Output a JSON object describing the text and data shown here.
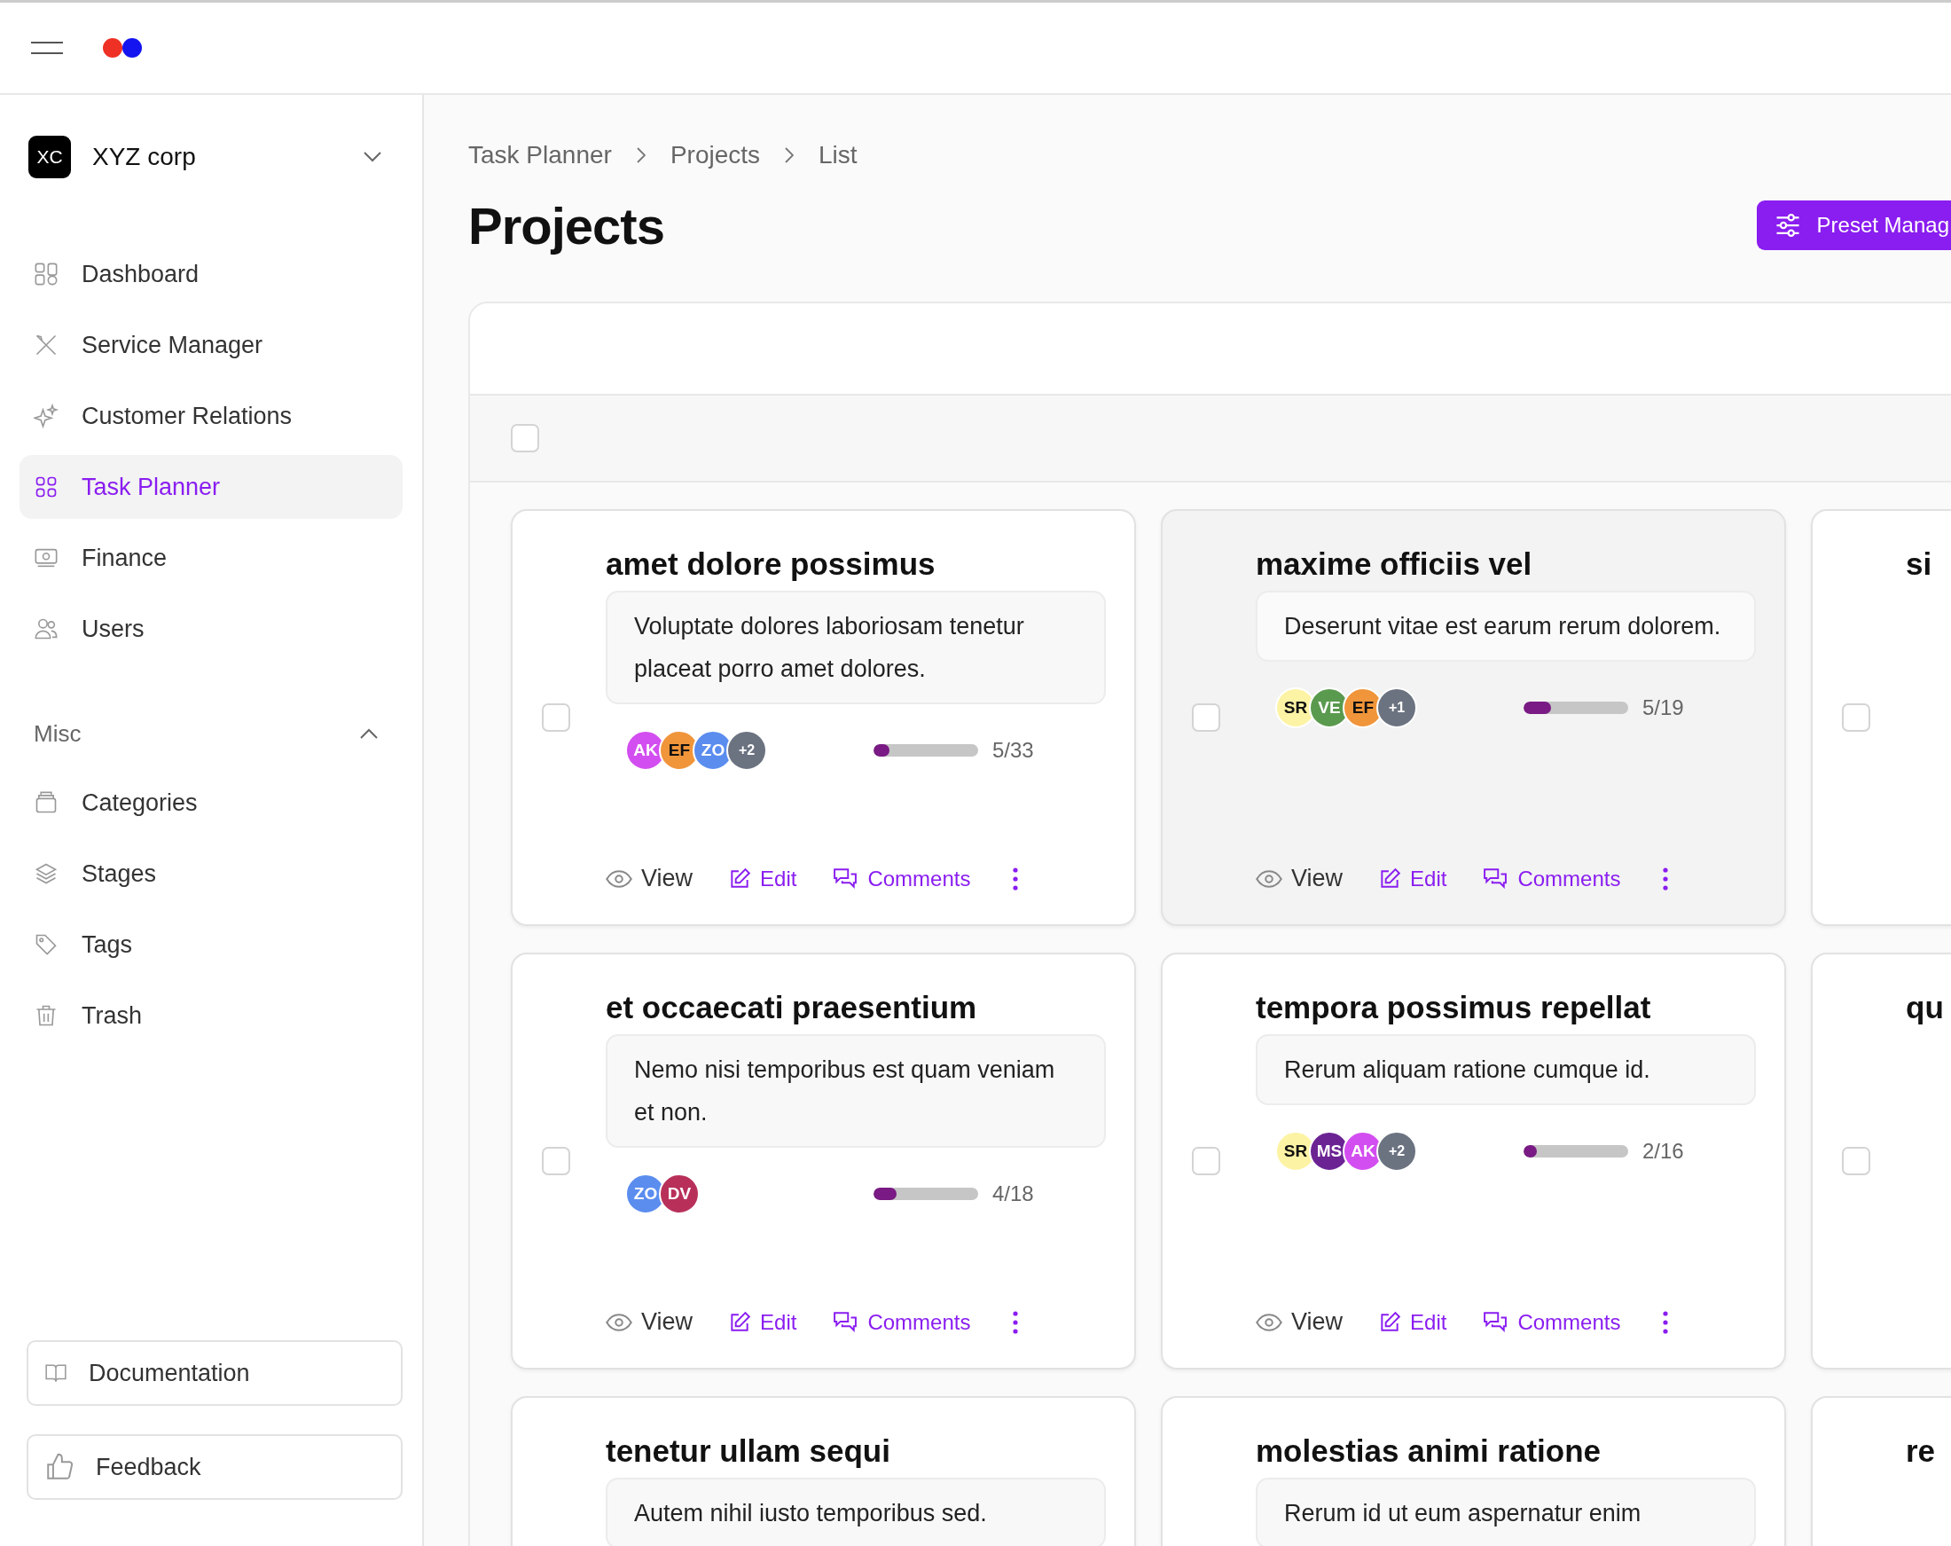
{
  "header": {
    "logo_dots": [
      {
        "color": "#ee3124"
      },
      {
        "color": "#1414f0"
      }
    ]
  },
  "org": {
    "badge": "XC",
    "name": "XYZ corp"
  },
  "nav": [
    {
      "label": "Dashboard",
      "selected": false
    },
    {
      "label": "Service Manager",
      "selected": false
    },
    {
      "label": "Customer Relations",
      "selected": false
    },
    {
      "label": "Task Planner",
      "selected": true
    },
    {
      "label": "Finance",
      "selected": false
    },
    {
      "label": "Users",
      "selected": false
    }
  ],
  "misc": {
    "label": "Misc",
    "expanded": true,
    "items": [
      {
        "label": "Categories",
        "selected": false
      },
      {
        "label": "Stages",
        "selected": false
      },
      {
        "label": "Tags",
        "selected": false
      },
      {
        "label": "Trash",
        "selected": false
      }
    ]
  },
  "footer_buttons": [
    "Documentation",
    "Feedback"
  ],
  "breadcrumb": [
    "Task Planner",
    "Projects",
    "List"
  ],
  "title": "Projects",
  "preset_button": "Preset Manag",
  "select_all": {
    "checked": false
  },
  "rows": [
    {
      "cards": [
        {
          "kind": "full",
          "title": "amet dolore possimus",
          "description": "Voluptate dolores laboriosam tenetur placeat porro amet dolores.",
          "checked": false,
          "highlighted": false,
          "avatars": [
            {
              "initials": "AK",
              "color": "#d34ef0"
            },
            {
              "initials": "EF",
              "color": "#f0953a"
            },
            {
              "initials": "ZO",
              "color": "#5b8def"
            }
          ],
          "more": "+2",
          "level": 0.15,
          "count": "5/33",
          "actions": [
            "View",
            "Edit",
            "Comments"
          ]
        },
        {
          "kind": "full",
          "title": "maxime officiis vel",
          "description": "Deserunt vitae est earum rerum dolorem.",
          "checked": false,
          "highlighted": true,
          "avatars": [
            {
              "initials": "SR",
              "color": "#fdf3a4"
            },
            {
              "initials": "VE",
              "color": "#5a9a4e"
            },
            {
              "initials": "EF",
              "color": "#f0953a"
            }
          ],
          "more": "+1",
          "level": 0.26,
          "count": "5/19",
          "actions": [
            "View",
            "Edit",
            "Comments"
          ]
        },
        {
          "kind": "clipped",
          "title": "si",
          "checked": false
        }
      ]
    },
    {
      "cards": [
        {
          "kind": "full",
          "title": "et occaecati praesentium",
          "description": "Nemo nisi temporibus est quam veniam et non.",
          "checked": false,
          "highlighted": false,
          "avatars": [
            {
              "initials": "ZO",
              "color": "#5b8def"
            },
            {
              "initials": "DV",
              "color": "#b8305a"
            }
          ],
          "level": 0.22,
          "count": "4/18",
          "actions": [
            "View",
            "Edit",
            "Comments"
          ]
        },
        {
          "kind": "full",
          "title": "tempora possimus repellat",
          "description": "Rerum aliquam ratione cumque id.",
          "checked": false,
          "highlighted": false,
          "avatars": [
            {
              "initials": "SR",
              "color": "#fdf3a4"
            },
            {
              "initials": "MS",
              "color": "#6b2394"
            },
            {
              "initials": "AK",
              "color": "#d34ef0"
            }
          ],
          "more": "+2",
          "level": 0.125,
          "count": "2/16",
          "actions": [
            "View",
            "Edit",
            "Comments"
          ]
        },
        {
          "kind": "clipped",
          "title": "qu",
          "checked": false
        }
      ]
    },
    {
      "cards": [
        {
          "kind": "full",
          "title": "tenetur ullam sequi",
          "description": "Autem nihil iusto temporibus sed."
        },
        {
          "kind": "full",
          "title": "molestias animi ratione",
          "description": "Rerum id ut eum aspernatur enim"
        },
        {
          "kind": "clipped",
          "title": "re"
        }
      ]
    }
  ]
}
